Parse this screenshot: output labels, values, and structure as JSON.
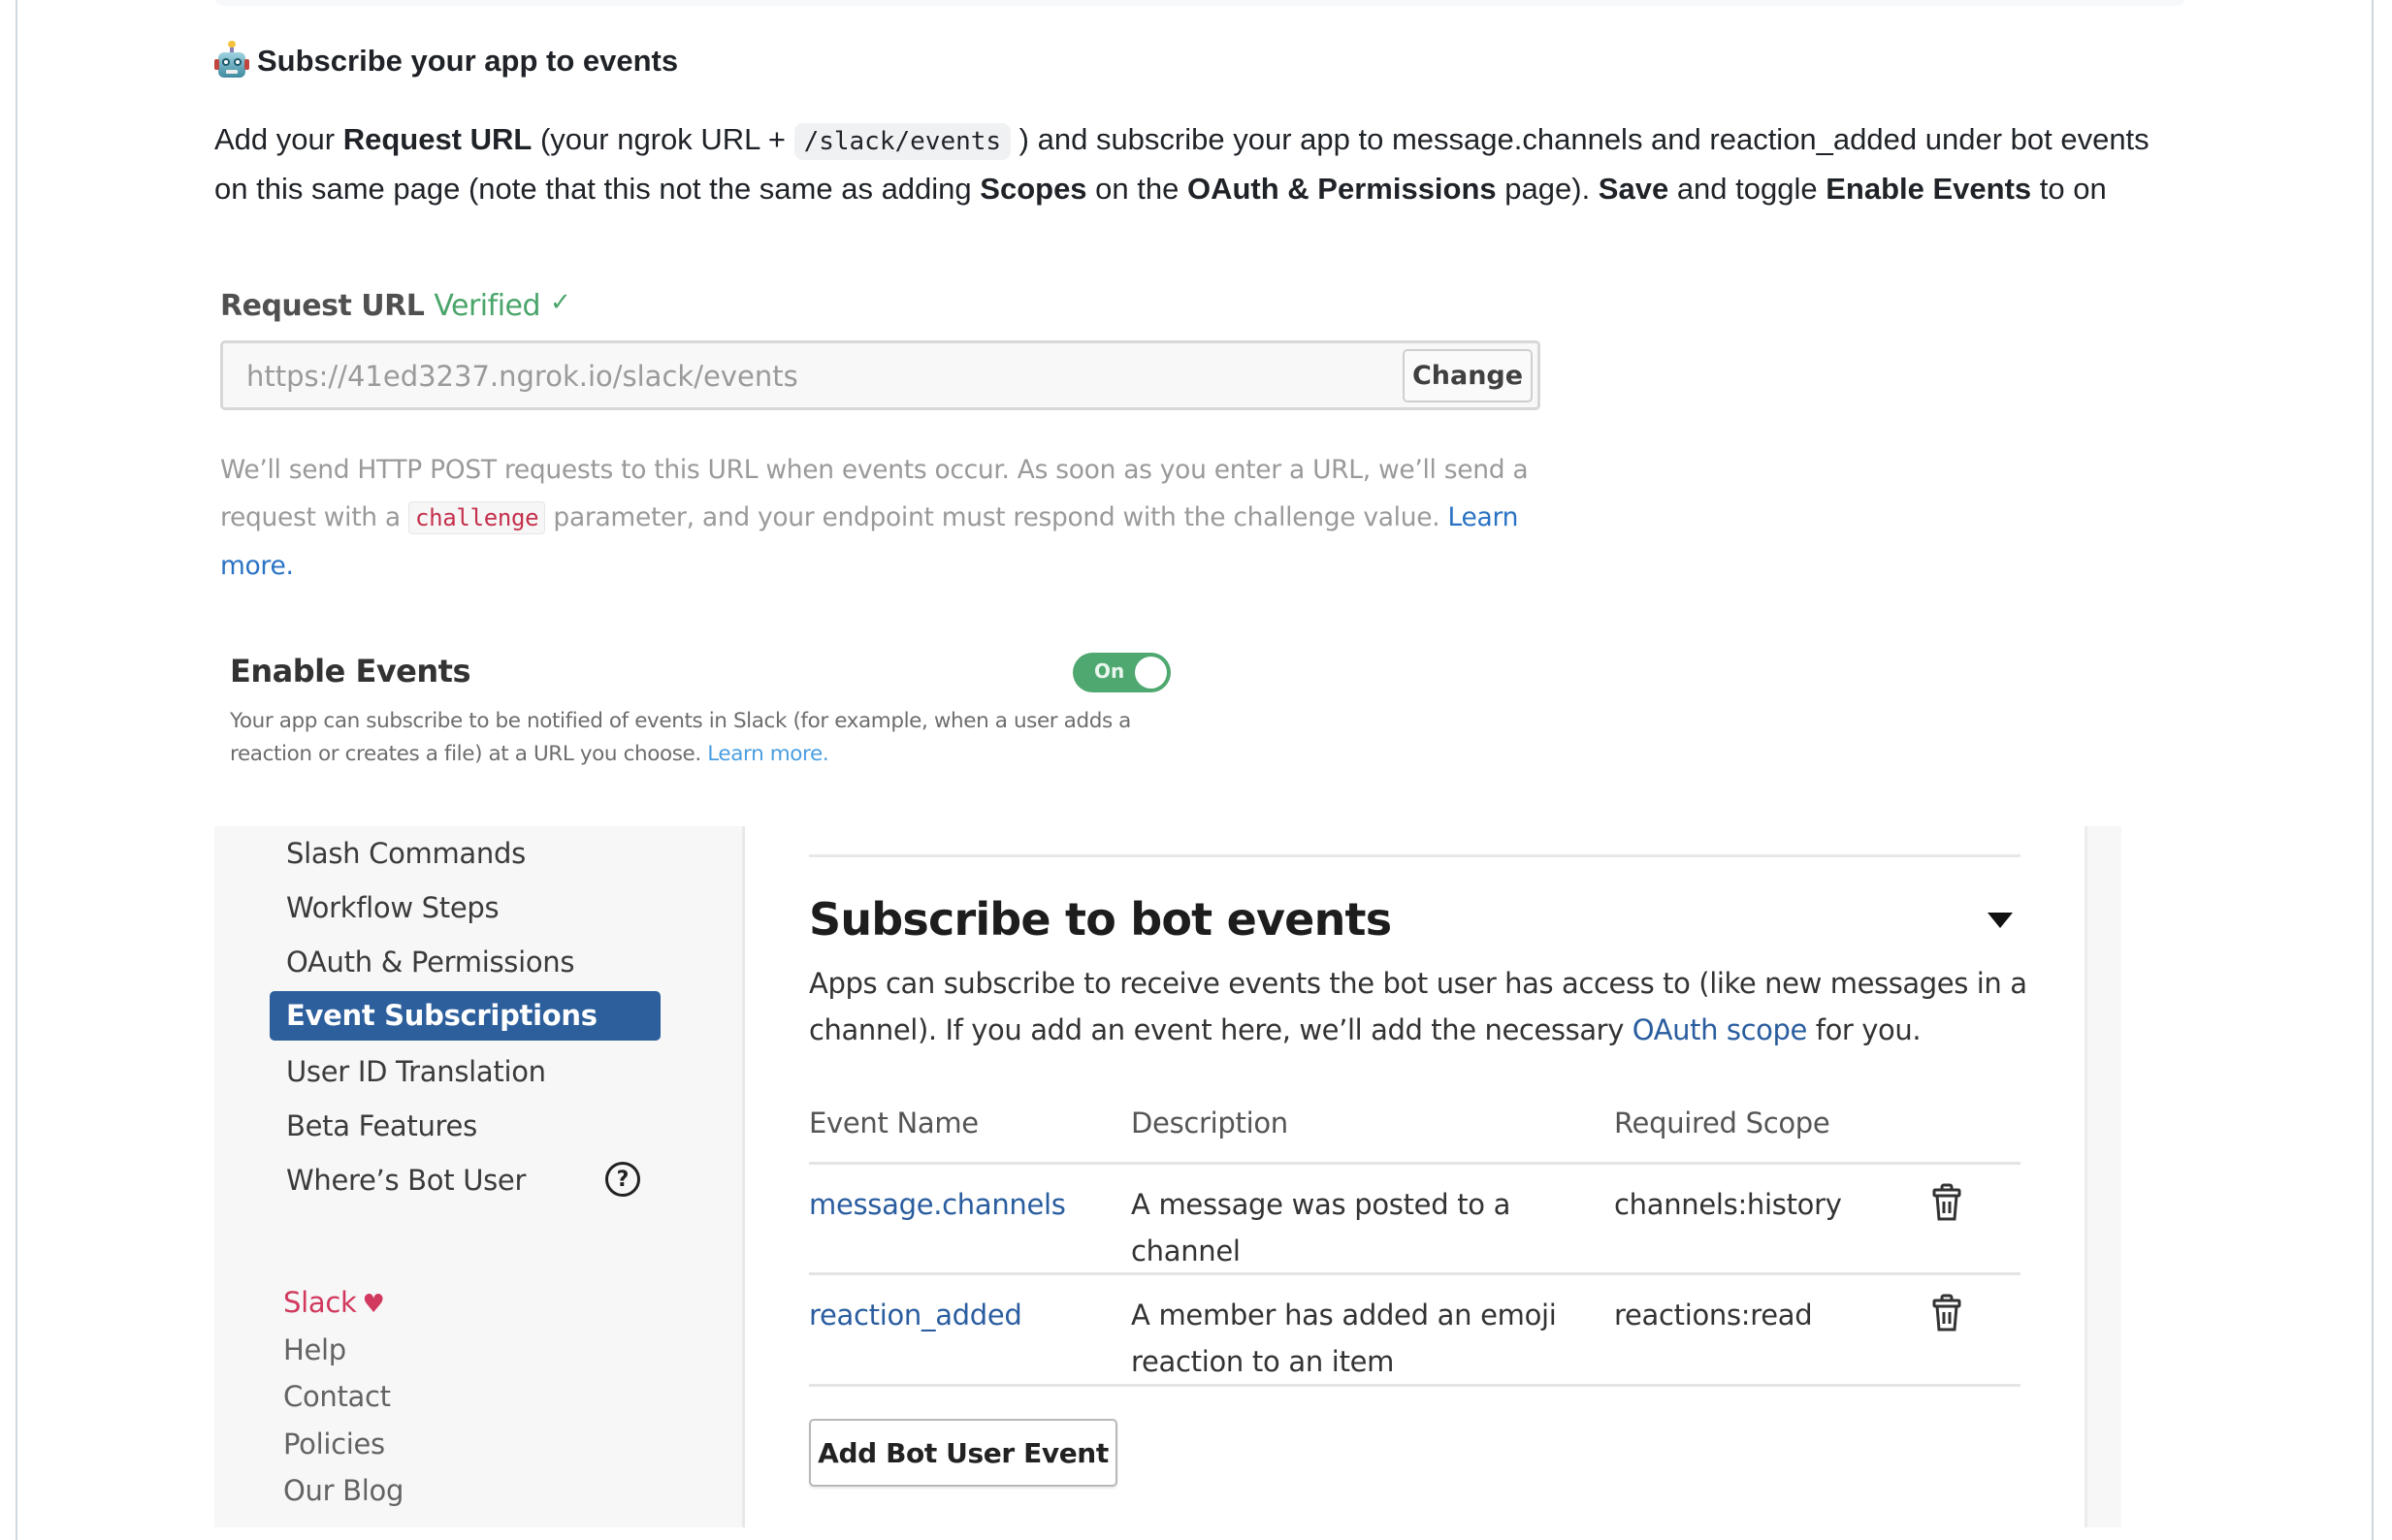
{
  "readme": {
    "heading_emoji": "robot-icon",
    "heading": "Subscribe your app to events",
    "paragraph": {
      "t1": "Add your ",
      "b1": "Request URL",
      "t2": " (your ngrok URL + ",
      "code": "/slack/events",
      "t3": " ) and subscribe your app to message.channels and reaction_added under bot events on this same page (note that this not the same as adding ",
      "b2": "Scopes",
      "t4": " on the ",
      "b3": "OAuth & Permissions",
      "t5": " page). ",
      "b4": "Save",
      "t6": " and toggle ",
      "b5": "Enable Events",
      "t7": " to on"
    }
  },
  "request_url": {
    "label": "Request URL",
    "status": "Verified",
    "status_icon": "✓",
    "value": "https://41ed3237.ngrok.io/slack/events",
    "change_label": "Change",
    "help": {
      "t1": "We’ll send HTTP POST requests to this URL when events occur. As soon as you enter a URL, we’ll send a request with a ",
      "code": "challenge",
      "t2": " parameter, and your endpoint must respond with the challenge value. ",
      "link": "Learn more."
    }
  },
  "enable_events": {
    "title": "Enable Events",
    "toggle_label": "On",
    "toggle_on": true,
    "description": "Your app can subscribe to be notified of events in Slack (for example, when a user adds a reaction or creates a file) at a URL you choose. ",
    "link": "Learn more."
  },
  "sidebar": {
    "items": [
      {
        "label": "Slash Commands"
      },
      {
        "label": "Workflow Steps"
      },
      {
        "label": "OAuth & Permissions"
      },
      {
        "label": "Event Subscriptions",
        "active": true
      },
      {
        "label": "User ID Translation"
      },
      {
        "label": "Beta Features"
      },
      {
        "label": "Where’s Bot User",
        "icon": "help-circle-icon"
      }
    ],
    "footer": [
      {
        "label": "Slack",
        "icon": "♥"
      },
      {
        "label": "Help"
      },
      {
        "label": "Contact"
      },
      {
        "label": "Policies"
      },
      {
        "label": "Our Blog"
      }
    ]
  },
  "bot_events": {
    "title": "Subscribe to bot events",
    "description": "Apps can subscribe to receive events the bot user has access to (like new messages in a channel). If you add an event here, we’ll add the necessary ",
    "description_link": "OAuth scope",
    "description_end": " for you.",
    "columns": [
      "Event Name",
      "Description",
      "Required Scope"
    ],
    "rows": [
      {
        "event": "message.channels",
        "description": "A message was posted to a channel",
        "scope": "channels:history"
      },
      {
        "event": "reaction_added",
        "description": "A member has added an emoji reaction to an item",
        "scope": "reactions:read"
      }
    ],
    "add_button": "Add Bot User Event"
  },
  "colors": {
    "verified_green": "#4aa56a",
    "active_blue": "#2c5f9c",
    "link_blue": "#2a5d9f",
    "slack_red": "#d1395e",
    "code_red": "#c5304c"
  }
}
